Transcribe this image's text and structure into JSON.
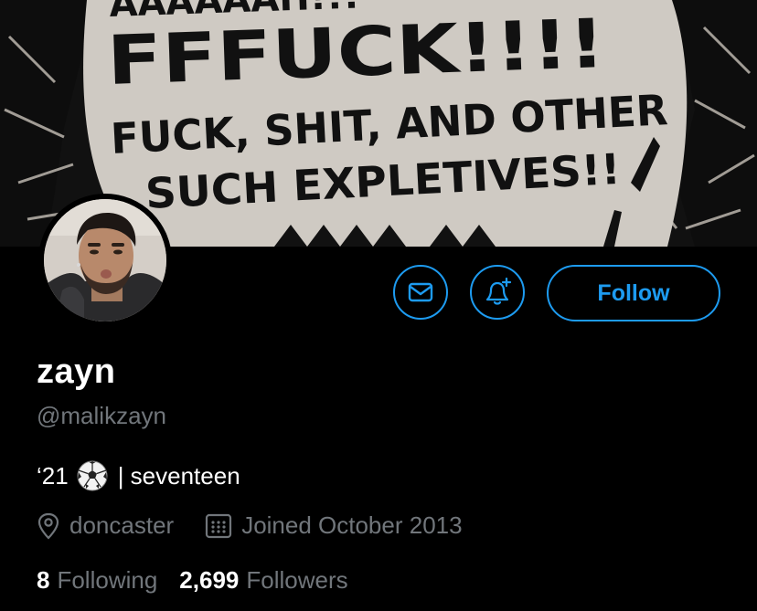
{
  "banner": {
    "lines": [
      "FFFUCK!!!!",
      "FUCK, SHIT, AND OTHER",
      "SUCH EXPLETIVES!!"
    ]
  },
  "profile": {
    "display_name": "zayn",
    "handle": "@malikzayn",
    "bio_prefix": "‘21",
    "bio_emoji": "soccer-ball",
    "bio_suffix": "| seventeen",
    "location": "doncaster",
    "joined": "Joined October 2013",
    "following_count": "8",
    "following_label": "Following",
    "followers_count": "2,699",
    "followers_label": "Followers"
  },
  "actions": {
    "message_icon": "envelope-icon",
    "notify_icon": "bell-plus-icon",
    "follow_label": "Follow"
  },
  "colors": {
    "accent": "#1d9bf0",
    "background": "#000000",
    "secondary_text": "#71767b"
  }
}
